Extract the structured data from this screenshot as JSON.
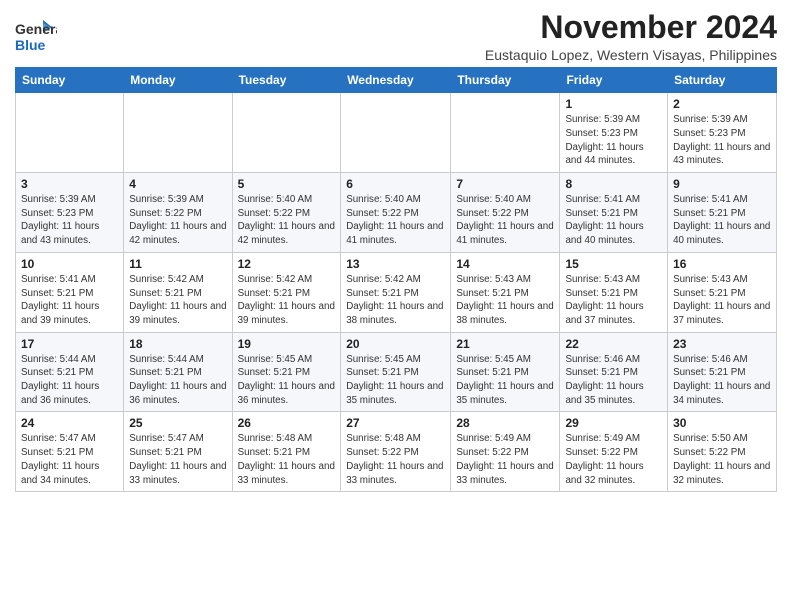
{
  "header": {
    "logo_general": "General",
    "logo_blue": "Blue",
    "month": "November 2024",
    "location": "Eustaquio Lopez, Western Visayas, Philippines"
  },
  "days_of_week": [
    "Sunday",
    "Monday",
    "Tuesday",
    "Wednesday",
    "Thursday",
    "Friday",
    "Saturday"
  ],
  "weeks": [
    [
      {
        "day": "",
        "info": ""
      },
      {
        "day": "",
        "info": ""
      },
      {
        "day": "",
        "info": ""
      },
      {
        "day": "",
        "info": ""
      },
      {
        "day": "",
        "info": ""
      },
      {
        "day": "1",
        "info": "Sunrise: 5:39 AM\nSunset: 5:23 PM\nDaylight: 11 hours and 44 minutes."
      },
      {
        "day": "2",
        "info": "Sunrise: 5:39 AM\nSunset: 5:23 PM\nDaylight: 11 hours and 43 minutes."
      }
    ],
    [
      {
        "day": "3",
        "info": "Sunrise: 5:39 AM\nSunset: 5:23 PM\nDaylight: 11 hours and 43 minutes."
      },
      {
        "day": "4",
        "info": "Sunrise: 5:39 AM\nSunset: 5:22 PM\nDaylight: 11 hours and 42 minutes."
      },
      {
        "day": "5",
        "info": "Sunrise: 5:40 AM\nSunset: 5:22 PM\nDaylight: 11 hours and 42 minutes."
      },
      {
        "day": "6",
        "info": "Sunrise: 5:40 AM\nSunset: 5:22 PM\nDaylight: 11 hours and 41 minutes."
      },
      {
        "day": "7",
        "info": "Sunrise: 5:40 AM\nSunset: 5:22 PM\nDaylight: 11 hours and 41 minutes."
      },
      {
        "day": "8",
        "info": "Sunrise: 5:41 AM\nSunset: 5:21 PM\nDaylight: 11 hours and 40 minutes."
      },
      {
        "day": "9",
        "info": "Sunrise: 5:41 AM\nSunset: 5:21 PM\nDaylight: 11 hours and 40 minutes."
      }
    ],
    [
      {
        "day": "10",
        "info": "Sunrise: 5:41 AM\nSunset: 5:21 PM\nDaylight: 11 hours and 39 minutes."
      },
      {
        "day": "11",
        "info": "Sunrise: 5:42 AM\nSunset: 5:21 PM\nDaylight: 11 hours and 39 minutes."
      },
      {
        "day": "12",
        "info": "Sunrise: 5:42 AM\nSunset: 5:21 PM\nDaylight: 11 hours and 39 minutes."
      },
      {
        "day": "13",
        "info": "Sunrise: 5:42 AM\nSunset: 5:21 PM\nDaylight: 11 hours and 38 minutes."
      },
      {
        "day": "14",
        "info": "Sunrise: 5:43 AM\nSunset: 5:21 PM\nDaylight: 11 hours and 38 minutes."
      },
      {
        "day": "15",
        "info": "Sunrise: 5:43 AM\nSunset: 5:21 PM\nDaylight: 11 hours and 37 minutes."
      },
      {
        "day": "16",
        "info": "Sunrise: 5:43 AM\nSunset: 5:21 PM\nDaylight: 11 hours and 37 minutes."
      }
    ],
    [
      {
        "day": "17",
        "info": "Sunrise: 5:44 AM\nSunset: 5:21 PM\nDaylight: 11 hours and 36 minutes."
      },
      {
        "day": "18",
        "info": "Sunrise: 5:44 AM\nSunset: 5:21 PM\nDaylight: 11 hours and 36 minutes."
      },
      {
        "day": "19",
        "info": "Sunrise: 5:45 AM\nSunset: 5:21 PM\nDaylight: 11 hours and 36 minutes."
      },
      {
        "day": "20",
        "info": "Sunrise: 5:45 AM\nSunset: 5:21 PM\nDaylight: 11 hours and 35 minutes."
      },
      {
        "day": "21",
        "info": "Sunrise: 5:45 AM\nSunset: 5:21 PM\nDaylight: 11 hours and 35 minutes."
      },
      {
        "day": "22",
        "info": "Sunrise: 5:46 AM\nSunset: 5:21 PM\nDaylight: 11 hours and 35 minutes."
      },
      {
        "day": "23",
        "info": "Sunrise: 5:46 AM\nSunset: 5:21 PM\nDaylight: 11 hours and 34 minutes."
      }
    ],
    [
      {
        "day": "24",
        "info": "Sunrise: 5:47 AM\nSunset: 5:21 PM\nDaylight: 11 hours and 34 minutes."
      },
      {
        "day": "25",
        "info": "Sunrise: 5:47 AM\nSunset: 5:21 PM\nDaylight: 11 hours and 33 minutes."
      },
      {
        "day": "26",
        "info": "Sunrise: 5:48 AM\nSunset: 5:21 PM\nDaylight: 11 hours and 33 minutes."
      },
      {
        "day": "27",
        "info": "Sunrise: 5:48 AM\nSunset: 5:22 PM\nDaylight: 11 hours and 33 minutes."
      },
      {
        "day": "28",
        "info": "Sunrise: 5:49 AM\nSunset: 5:22 PM\nDaylight: 11 hours and 33 minutes."
      },
      {
        "day": "29",
        "info": "Sunrise: 5:49 AM\nSunset: 5:22 PM\nDaylight: 11 hours and 32 minutes."
      },
      {
        "day": "30",
        "info": "Sunrise: 5:50 AM\nSunset: 5:22 PM\nDaylight: 11 hours and 32 minutes."
      }
    ]
  ]
}
